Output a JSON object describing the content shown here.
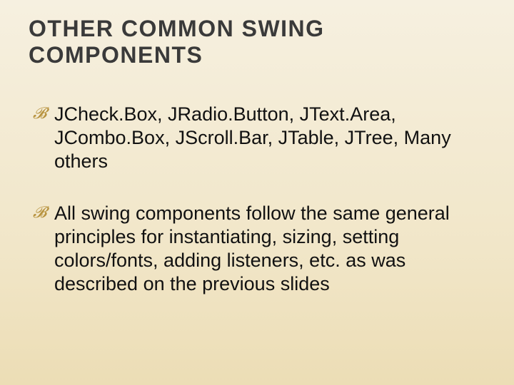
{
  "title": "OTHER COMMON SWING COMPONENTS",
  "bullets": [
    "JCheck.Box, JRadio.Button, JText.Area, JCombo.Box, JScroll.Bar, JTable, JTree, Many others",
    "All swing components follow the same general principles for instantiating, sizing, setting colors/fonts, adding listeners, etc. as was described on the previous slides"
  ]
}
